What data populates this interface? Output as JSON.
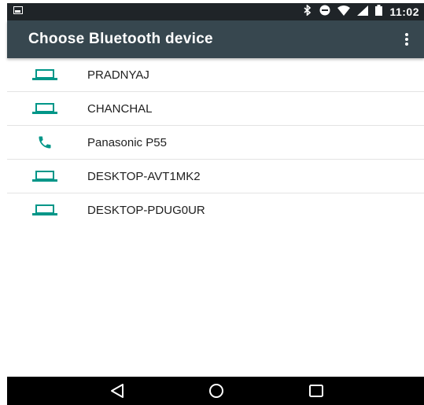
{
  "status_bar": {
    "time": "11:02",
    "icons": [
      "image-icon",
      "bluetooth-icon",
      "do-not-disturb-icon",
      "wifi-icon",
      "signal-icon",
      "battery-icon"
    ]
  },
  "app_bar": {
    "title": "Choose Bluetooth device",
    "overflow_icon": "more-vert-icon"
  },
  "devices": [
    {
      "name": "PRADNYAJ",
      "icon": "laptop-icon"
    },
    {
      "name": "CHANCHAL",
      "icon": "laptop-icon"
    },
    {
      "name": "Panasonic P55",
      "icon": "phone-icon"
    },
    {
      "name": "DESKTOP-AVT1MK2",
      "icon": "laptop-icon"
    },
    {
      "name": "DESKTOP-PDUG0UR",
      "icon": "laptop-icon"
    }
  ],
  "nav_bar": {
    "icons": [
      "back-icon",
      "home-icon",
      "recents-icon"
    ]
  },
  "colors": {
    "status_bar": "#1f2428",
    "app_bar": "#37474f",
    "accent": "#009688",
    "nav_bar": "#000000"
  }
}
